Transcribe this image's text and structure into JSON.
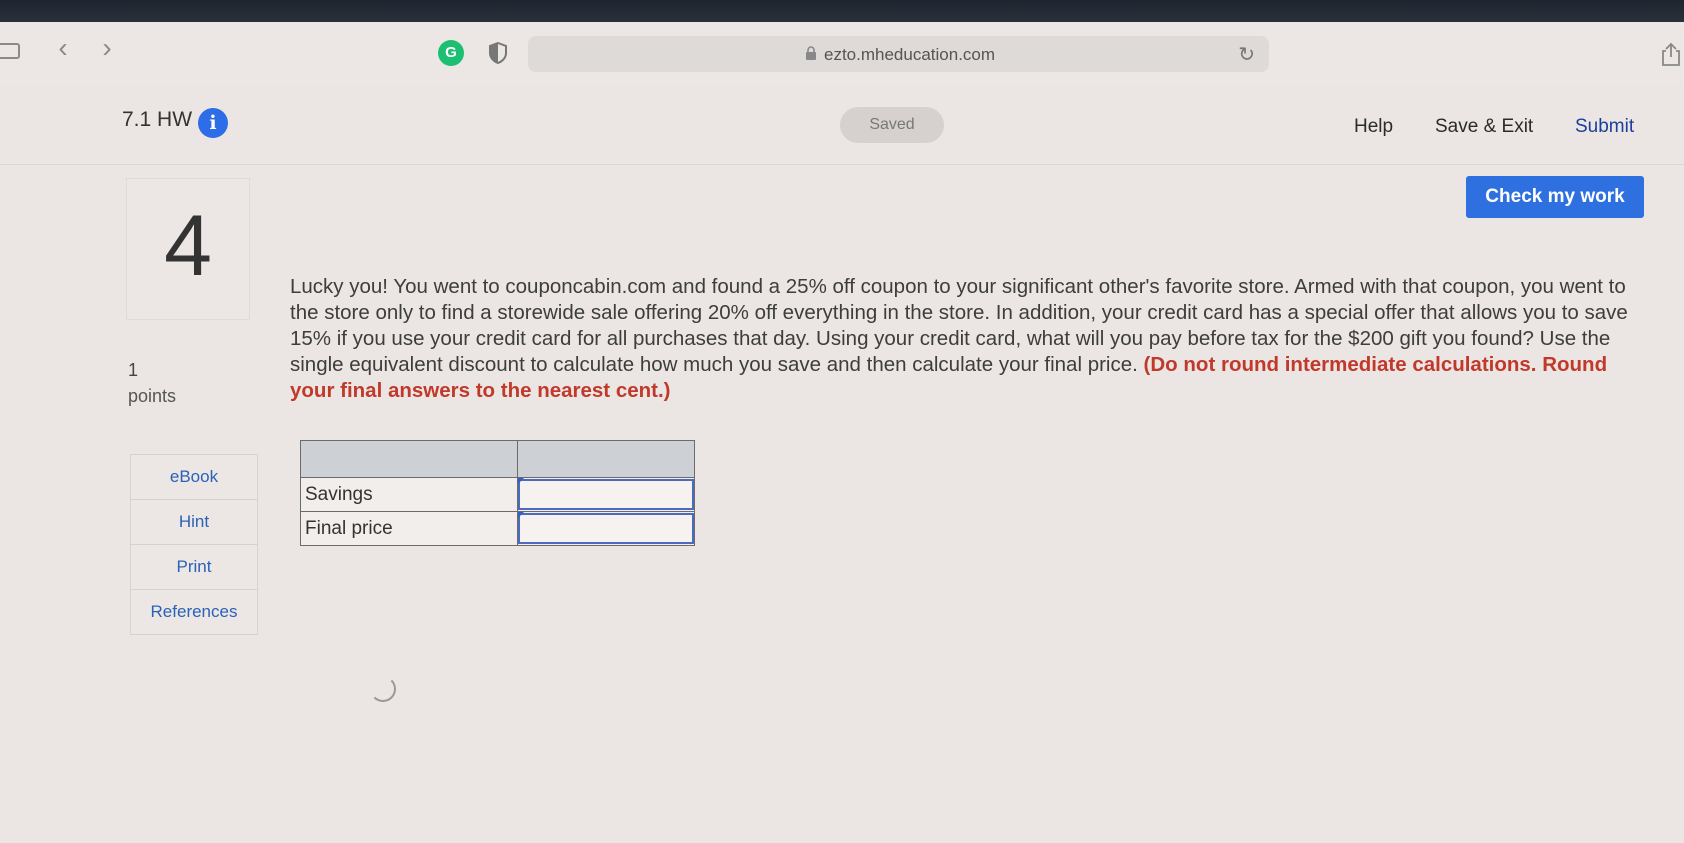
{
  "browser": {
    "url": "ezto.mheducation.com",
    "nav_back": "‹",
    "nav_forward": "›",
    "extension_g": "G"
  },
  "header": {
    "assignment_title": "7.1 HW",
    "info_icon_glyph": "i",
    "saved_status": "Saved",
    "help_label": "Help",
    "save_exit_label": "Save & Exit",
    "submit_label": "Submit"
  },
  "question": {
    "number": "4",
    "points_value": "1",
    "points_label": "points",
    "text": "Lucky you! You went to couponcabin.com and found a 25% off coupon to your significant other's favorite store. Armed with that coupon, you went to the store only to find a storewide sale offering 20% off everything in the store. In addition, your credit card has a special offer that allows you to save 15% if you use your credit card for all purchases that day. Using your credit card, what will you pay before tax for the $200 gift you found? Use the single equivalent discount to calculate how much you save and then calculate your final price.",
    "note": "(Do not round intermediate calculations. Round your final answers to the nearest cent.)",
    "check_button_label": "Check my work"
  },
  "tools": {
    "items": [
      "eBook",
      "Hint",
      "Print",
      "References"
    ]
  },
  "answer_table": {
    "rows": [
      {
        "label": "Savings",
        "value": ""
      },
      {
        "label": "Final price",
        "value": ""
      }
    ]
  },
  "colors": {
    "accent": "#2f70e0",
    "note_red": "#c0392b",
    "link_blue": "#2a62b8"
  }
}
